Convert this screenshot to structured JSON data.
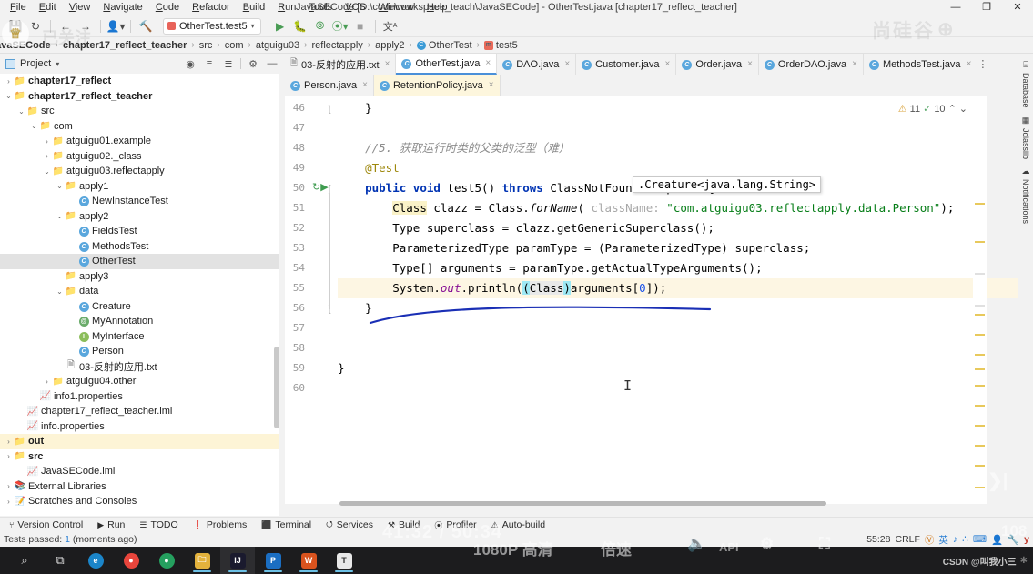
{
  "window": {
    "title": "JavaSECode [D:\\code\\workspace_teach\\JavaSECode] - OtherTest.java [chapter17_reflect_teacher]",
    "minimize": "—",
    "maximize": "❐",
    "close": "✕"
  },
  "menu": [
    "File",
    "Edit",
    "View",
    "Navigate",
    "Code",
    "Refactor",
    "Build",
    "Run",
    "Tools",
    "VCS",
    "Window",
    "Help"
  ],
  "toolbar": {
    "run_config": "OtherTest.test5",
    "icons": [
      "save-icon",
      "sync-icon",
      "back-arrow-icon",
      "forward-arrow-icon",
      "profile-icon",
      "build-hammer-icon"
    ],
    "run_icon": "▶",
    "debug_icon": "🐞",
    "run_cov_icon": "⭮",
    "profile_icon": "⦿",
    "stop_icon": "■",
    "translate_icon": "文A"
  },
  "breadcrumb": [
    {
      "label": "JavaSECode",
      "type": "root"
    },
    {
      "label": "chapter17_reflect_teacher",
      "type": "module"
    },
    {
      "label": "src",
      "type": "dir"
    },
    {
      "label": "com",
      "type": "dir"
    },
    {
      "label": "atguigu03",
      "type": "dir"
    },
    {
      "label": "reflectapply",
      "type": "dir"
    },
    {
      "label": "apply2",
      "type": "dir"
    },
    {
      "label": "OtherTest",
      "type": "class"
    },
    {
      "label": "test5",
      "type": "method"
    }
  ],
  "project_panel": {
    "title": "Project",
    "header_icons": [
      "locate-icon",
      "expand-all-icon",
      "collapse-all-icon",
      "settings-gear-icon",
      "hide-icon"
    ],
    "tree": [
      {
        "indent": 0,
        "arrow": "›",
        "icon": "module",
        "label": "chapter17_reflect",
        "bold": true
      },
      {
        "indent": 0,
        "arrow": "⌄",
        "icon": "module",
        "label": "chapter17_reflect_teacher",
        "bold": true
      },
      {
        "indent": 1,
        "arrow": "⌄",
        "icon": "src-folder",
        "label": "src"
      },
      {
        "indent": 2,
        "arrow": "⌄",
        "icon": "pkg",
        "label": "com"
      },
      {
        "indent": 3,
        "arrow": "›",
        "icon": "pkg",
        "label": "atguigu01.example"
      },
      {
        "indent": 3,
        "arrow": "›",
        "icon": "pkg",
        "label": "atguigu02._class"
      },
      {
        "indent": 3,
        "arrow": "⌄",
        "icon": "pkg",
        "label": "atguigu03.reflectapply"
      },
      {
        "indent": 4,
        "arrow": "⌄",
        "icon": "pkg",
        "label": "apply1"
      },
      {
        "indent": 5,
        "arrow": "",
        "icon": "class",
        "label": "NewInstanceTest"
      },
      {
        "indent": 4,
        "arrow": "⌄",
        "icon": "pkg",
        "label": "apply2"
      },
      {
        "indent": 5,
        "arrow": "",
        "icon": "class",
        "label": "FieldsTest"
      },
      {
        "indent": 5,
        "arrow": "",
        "icon": "class",
        "label": "MethodsTest"
      },
      {
        "indent": 5,
        "arrow": "",
        "icon": "class",
        "label": "OtherTest",
        "selected": true
      },
      {
        "indent": 4,
        "arrow": "",
        "icon": "pkg",
        "label": "apply3"
      },
      {
        "indent": 4,
        "arrow": "⌄",
        "icon": "pkg",
        "label": "data"
      },
      {
        "indent": 5,
        "arrow": "",
        "icon": "class",
        "label": "Creature"
      },
      {
        "indent": 5,
        "arrow": "",
        "icon": "annotation",
        "label": "MyAnnotation"
      },
      {
        "indent": 5,
        "arrow": "",
        "icon": "interface",
        "label": "MyInterface"
      },
      {
        "indent": 5,
        "arrow": "",
        "icon": "class",
        "label": "Person"
      },
      {
        "indent": 4,
        "arrow": "",
        "icon": "text",
        "label": "03-反射的应用.txt"
      },
      {
        "indent": 3,
        "arrow": "›",
        "icon": "pkg",
        "label": "atguigu04.other"
      },
      {
        "indent": 2,
        "arrow": "",
        "icon": "properties",
        "label": "info1.properties"
      },
      {
        "indent": 1,
        "arrow": "",
        "icon": "iml",
        "label": "chapter17_reflect_teacher.iml"
      },
      {
        "indent": 1,
        "arrow": "",
        "icon": "properties",
        "label": "info.properties"
      },
      {
        "indent": 0,
        "arrow": "›",
        "icon": "out-folder",
        "label": "out",
        "bold": true,
        "highlight": true
      },
      {
        "indent": 0,
        "arrow": "›",
        "icon": "src-folder",
        "label": "src",
        "bold": true
      },
      {
        "indent": 1,
        "arrow": "",
        "icon": "iml",
        "label": "JavaSECode.iml"
      },
      {
        "indent": -1,
        "arrow": "›",
        "icon": "lib",
        "label": "External Libraries"
      },
      {
        "indent": -1,
        "arrow": "›",
        "icon": "scratch",
        "label": "Scratches and Consoles"
      }
    ]
  },
  "editor_tabs": {
    "row1": [
      {
        "label": "03-反射的应用.txt",
        "icon": "text-file-icon",
        "active": false
      },
      {
        "label": "OtherTest.java",
        "icon": "class-icon",
        "active": true
      },
      {
        "label": "DAO.java",
        "icon": "class-icon",
        "active": false
      },
      {
        "label": "Customer.java",
        "icon": "class-icon",
        "active": false
      },
      {
        "label": "Order.java",
        "icon": "class-icon",
        "active": false
      },
      {
        "label": "OrderDAO.java",
        "icon": "class-icon",
        "active": false
      },
      {
        "label": "MethodsTest.java",
        "icon": "class-icon",
        "active": false
      }
    ],
    "row2": [
      {
        "label": "Person.java",
        "icon": "class-icon",
        "active": false
      },
      {
        "label": "RetentionPolicy.java",
        "icon": "class-icon",
        "active": false,
        "highlight": true
      }
    ],
    "overflow": "⋮"
  },
  "editor": {
    "inspection": {
      "warnings": "11",
      "warning_icon": "warning-triangle-icon",
      "ok": "10",
      "ok_icon": "check-icon",
      "up": "⌃",
      "down": "⌄"
    },
    "tooltip": ".Creature<java.lang.String>",
    "lines": [
      {
        "n": "46",
        "text": "    }"
      },
      {
        "n": "47",
        "text": ""
      },
      {
        "n": "48",
        "text": "    //5. 获取运行时类的父类的泛型（难）"
      },
      {
        "n": "49",
        "text": "    @Test"
      },
      {
        "n": "50",
        "text": "    public void test5() throws ClassNotFoundException {"
      },
      {
        "n": "51",
        "text": "        Class clazz = Class.forName( className: \"com.atguigu03.reflectapply.data.Person\");"
      },
      {
        "n": "52",
        "text": "        Type superclass = clazz.getGenericSuperclass();"
      },
      {
        "n": "53",
        "text": "        ParameterizedType paramType = (ParameterizedType) superclass;"
      },
      {
        "n": "54",
        "text": "        Type[] arguments = paramType.getActualTypeArguments();"
      },
      {
        "n": "55",
        "text": "        System.out.println((Class)arguments[0]);"
      },
      {
        "n": "56",
        "text": "    }"
      },
      {
        "n": "57",
        "text": ""
      },
      {
        "n": "58",
        "text": ""
      },
      {
        "n": "59",
        "text": "}"
      },
      {
        "n": "60",
        "text": ""
      }
    ]
  },
  "right_strip": [
    {
      "label": "Database",
      "icon": "database-icon"
    },
    {
      "label": "Jclasslib",
      "icon": "jclasslib-icon"
    },
    {
      "label": "Notifications",
      "icon": "notifications-icon"
    }
  ],
  "bottom_bar": [
    {
      "label": "Version Control",
      "icon": "branch-icon"
    },
    {
      "label": "Run",
      "icon": "play-icon"
    },
    {
      "label": "TODO",
      "icon": "list-icon"
    },
    {
      "label": "Problems",
      "icon": "error-icon"
    },
    {
      "label": "Terminal",
      "icon": "terminal-icon"
    },
    {
      "label": "Services",
      "icon": "services-icon"
    },
    {
      "label": "Build",
      "icon": "hammer-icon"
    },
    {
      "label": "Profiler",
      "icon": "profiler-icon"
    },
    {
      "label": "Auto-build",
      "icon": "warning-icon"
    }
  ],
  "status_bar": {
    "message_prefix": "Tests passed: ",
    "message_count": "1",
    "message_suffix": " (moments ago)",
    "caret_position": "55:28",
    "line_separator": "CRLF",
    "tray": [
      "英",
      "♪",
      "∴",
      "keyboard-icon",
      "user-icon",
      "wrench-icon"
    ]
  },
  "taskbar": {
    "items": [
      {
        "name": "search-icon",
        "glyph": "⌕"
      },
      {
        "name": "task-view-icon",
        "glyph": "⧉"
      },
      {
        "name": "edge-icon",
        "glyph": "e"
      },
      {
        "name": "chrome-icon",
        "glyph": "●"
      },
      {
        "name": "chrome-beta-icon",
        "glyph": "●"
      },
      {
        "name": "file-explorer-icon",
        "glyph": "🗀"
      },
      {
        "name": "intellij-idea-icon",
        "glyph": "IJ"
      },
      {
        "name": "powerpoint-icon",
        "glyph": "P"
      },
      {
        "name": "editor-icon",
        "glyph": "W"
      },
      {
        "name": "notes-icon",
        "glyph": "T"
      }
    ],
    "tray_text": "CSDN @叫我小三"
  },
  "overlay": {
    "follow_label": "已关注",
    "brand": "尚硅谷",
    "quality": "1080P 高清",
    "speed": "倍速",
    "time": "41:32 / 50:34",
    "pct": "108"
  },
  "colors": {
    "accent": "#4a90d9",
    "keyword": "#0033b3",
    "string": "#067d17",
    "comment": "#8c8c8c",
    "field": "#871094",
    "selection": "#9ee9f5",
    "highlight_row": "#fdf6e3"
  }
}
